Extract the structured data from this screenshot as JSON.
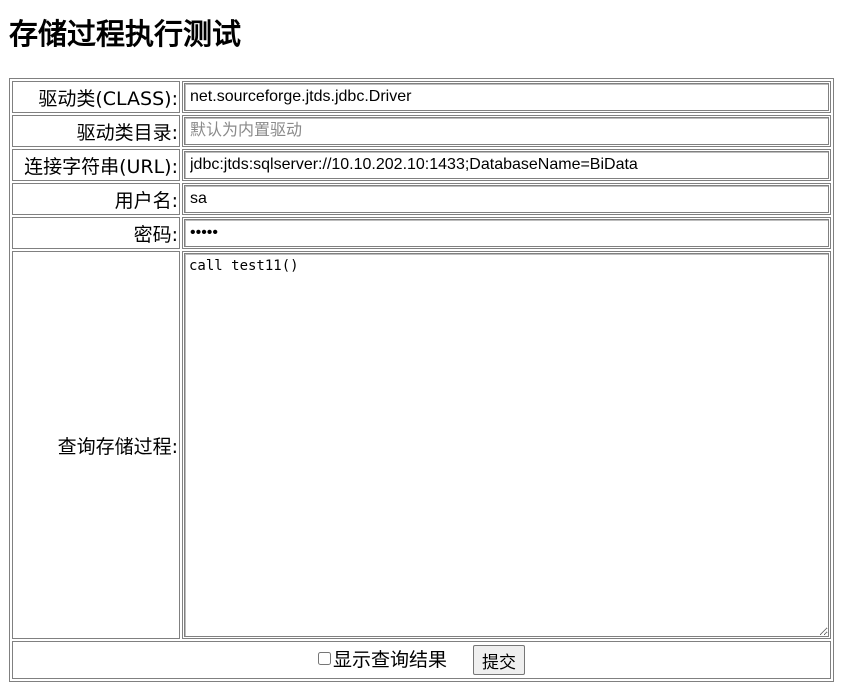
{
  "page": {
    "title": "存储过程执行测试"
  },
  "form": {
    "driver_class": {
      "label": "驱动类(CLASS):",
      "value": "net.sourceforge.jtds.jdbc.Driver"
    },
    "driver_dir": {
      "label": "驱动类目录:",
      "value": "",
      "placeholder": "默认为内置驱动"
    },
    "connection_url": {
      "label": "连接字符串(URL):",
      "value": "jdbc:jtds:sqlserver://10.10.202.10:1433;DatabaseName=BiData"
    },
    "username": {
      "label": "用户名:",
      "value": "sa"
    },
    "password": {
      "label": "密码:",
      "value": "•••••"
    },
    "procedure": {
      "label": "查询存储过程:",
      "value": "call test11()"
    },
    "show_results": {
      "label": "显示查询结果",
      "checked": false
    },
    "submit_label": "提交"
  }
}
